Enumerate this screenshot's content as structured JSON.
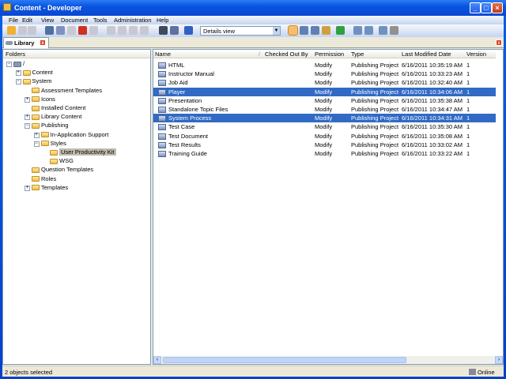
{
  "window": {
    "title": "Content - Developer",
    "controls": [
      "minimize",
      "maximize",
      "close"
    ]
  },
  "menu": [
    "File",
    "Edit",
    "View",
    "Document",
    "Tools",
    "Administration",
    "Help"
  ],
  "toolbar": {
    "view_select": "Details view"
  },
  "tab": {
    "label": "Library"
  },
  "folders": {
    "header": "Folders",
    "items": [
      {
        "label": "/",
        "level": 0,
        "expander": "minus"
      },
      {
        "label": "Content",
        "level": 1,
        "expander": "plus"
      },
      {
        "label": "System",
        "level": 1,
        "expander": "minus"
      },
      {
        "label": "Assessment Templates",
        "level": 2,
        "expander": ""
      },
      {
        "label": "Icons",
        "level": 2,
        "expander": "plus"
      },
      {
        "label": "Installed Content",
        "level": 2,
        "expander": ""
      },
      {
        "label": "Library Content",
        "level": 2,
        "expander": "plus"
      },
      {
        "label": "Publishing",
        "level": 2,
        "expander": "minus"
      },
      {
        "label": "In-Application Support",
        "level": 3,
        "expander": "plus"
      },
      {
        "label": "Styles",
        "level": 3,
        "expander": "minus"
      },
      {
        "label": "User Productivity Kit",
        "level": 4,
        "expander": "",
        "selected": true
      },
      {
        "label": "WSG",
        "level": 4,
        "expander": ""
      },
      {
        "label": "Question Templates",
        "level": 2,
        "expander": ""
      },
      {
        "label": "Roles",
        "level": 2,
        "expander": ""
      },
      {
        "label": "Templates",
        "level": 2,
        "expander": "plus"
      }
    ]
  },
  "list": {
    "columns": [
      "Name",
      "Checked Out By",
      "Permission",
      "Type",
      "Last Modified Date",
      "Version"
    ],
    "rows": [
      {
        "name": "HTML",
        "checked_out_by": "",
        "permission": "Modify",
        "type": "Publishing Project",
        "modified": "6/16/2011 10:35:19 AM",
        "version": "1"
      },
      {
        "name": "Instructor Manual",
        "checked_out_by": "",
        "permission": "Modify",
        "type": "Publishing Project",
        "modified": "6/16/2011 10:33:23 AM",
        "version": "1"
      },
      {
        "name": "Job Aid",
        "checked_out_by": "",
        "permission": "Modify",
        "type": "Publishing Project",
        "modified": "6/16/2011 10:32:40 AM",
        "version": "1"
      },
      {
        "name": "Player",
        "checked_out_by": "",
        "permission": "Modify",
        "type": "Publishing Project",
        "modified": "6/16/2011 10:34:06 AM",
        "version": "1",
        "selected": true
      },
      {
        "name": "Presentation",
        "checked_out_by": "",
        "permission": "Modify",
        "type": "Publishing Project",
        "modified": "6/16/2011 10:35:38 AM",
        "version": "1"
      },
      {
        "name": "Standalone Topic Files",
        "checked_out_by": "",
        "permission": "Modify",
        "type": "Publishing Project",
        "modified": "6/16/2011 10:34:47 AM",
        "version": "1"
      },
      {
        "name": "System Process",
        "checked_out_by": "",
        "permission": "Modify",
        "type": "Publishing Project",
        "modified": "6/16/2011 10:34:31 AM",
        "version": "1",
        "selected": true
      },
      {
        "name": "Test Case",
        "checked_out_by": "",
        "permission": "Modify",
        "type": "Publishing Project",
        "modified": "6/16/2011 10:35:30 AM",
        "version": "1"
      },
      {
        "name": "Test Document",
        "checked_out_by": "",
        "permission": "Modify",
        "type": "Publishing Project",
        "modified": "6/16/2011 10:35:08 AM",
        "version": "1"
      },
      {
        "name": "Test Results",
        "checked_out_by": "",
        "permission": "Modify",
        "type": "Publishing Project",
        "modified": "6/16/2011 10:33:02 AM",
        "version": "1"
      },
      {
        "name": "Training Guide",
        "checked_out_by": "",
        "permission": "Modify",
        "type": "Publishing Project",
        "modified": "6/16/2011 10:33:22 AM",
        "version": "1"
      }
    ]
  },
  "status": {
    "message": "2 objects selected",
    "connection": "Online"
  },
  "colors": {
    "selection": "#316ac5",
    "titlebar": "#0a55e0"
  }
}
